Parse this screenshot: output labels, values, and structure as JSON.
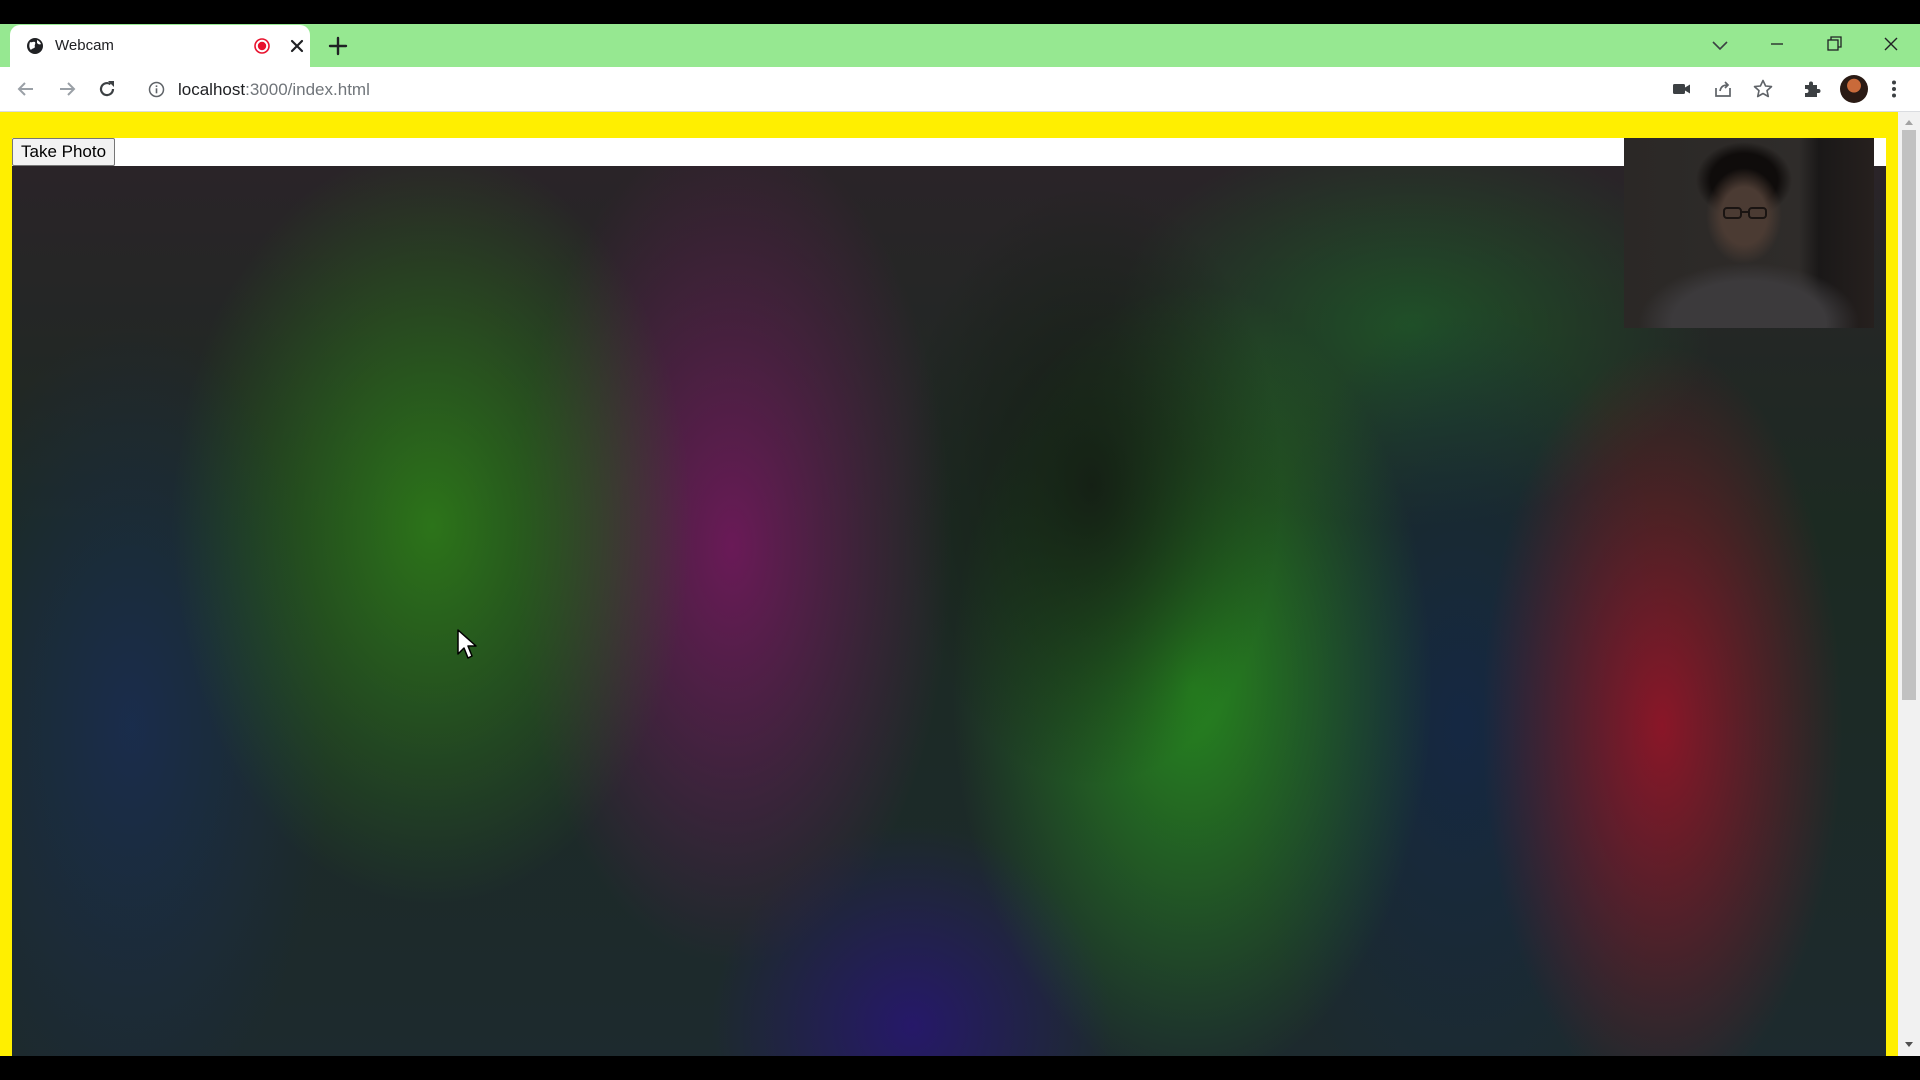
{
  "tab": {
    "title": "Webcam"
  },
  "address_bar": {
    "host": "localhost",
    "path": ":3000/index.html"
  },
  "page": {
    "take_photo_label": "Take Photo"
  },
  "icons": {
    "favicon": "globe-icon",
    "recording": "record-icon",
    "tab_close": "close-icon",
    "new_tab": "plus-icon",
    "tab_search": "chevron-down-icon",
    "window_controls": [
      "minimize-icon",
      "restore-icon",
      "close-icon"
    ],
    "toolbar": [
      "back-arrow-icon",
      "forward-arrow-icon",
      "reload-icon",
      "info-icon",
      "camera-icon",
      "share-icon",
      "star-icon",
      "puzzle-icon",
      "more-vert-icon"
    ]
  },
  "colors": {
    "tab_strip": "#96e891",
    "page_background": "#ffef00",
    "recording_dot": "#e8112d"
  }
}
